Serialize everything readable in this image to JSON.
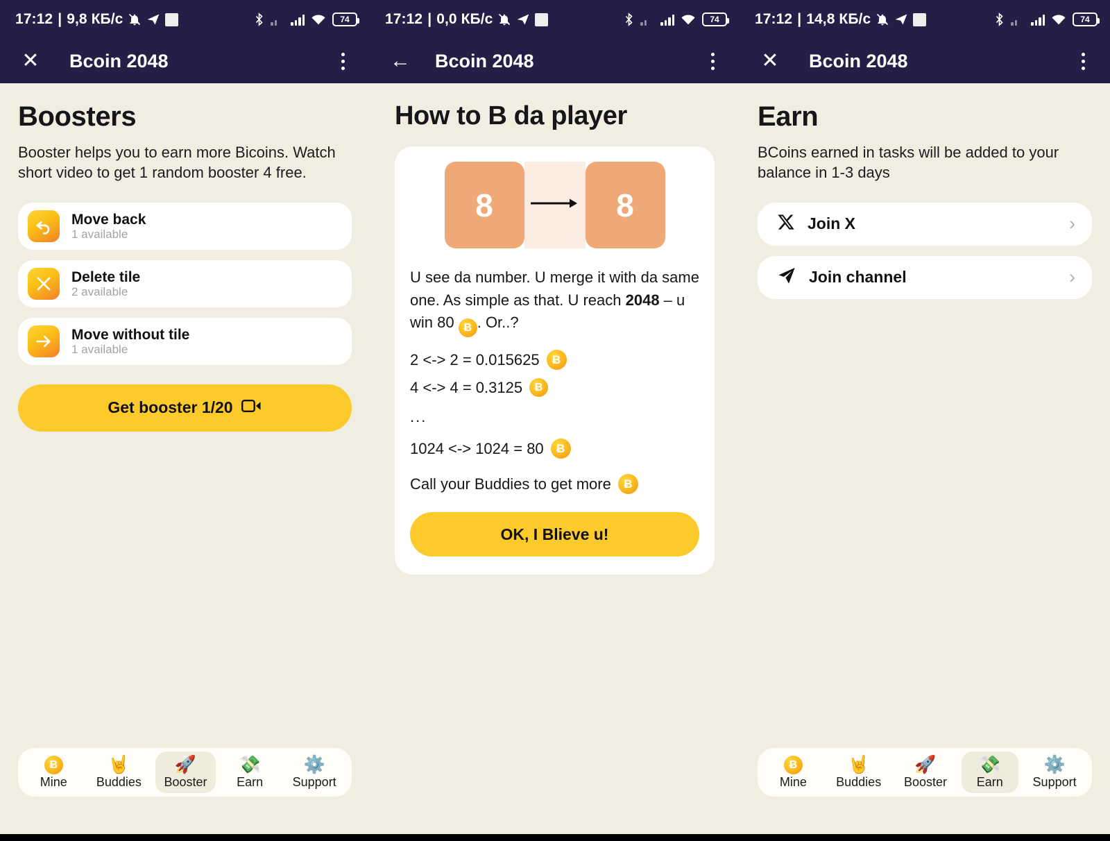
{
  "app": {
    "title": "Bcoin 2048"
  },
  "panels": [
    {
      "status": {
        "time": "17:12",
        "separator": "|",
        "net_speed": "9,8 КБ/с",
        "mute_icon": "mute-bell-icon",
        "telegram_icon": "telegram-icon",
        "screenshot_icon": "square-icon",
        "bluetooth_icon": "bluetooth-icon",
        "signal1_icon": "signal-no-sim-icon",
        "signal2_icon": "signal-bars-icon",
        "wifi_icon": "wifi-icon",
        "battery": "74"
      },
      "appbar": {
        "nav_icon": "close-icon",
        "nav_glyph": "✕",
        "title": "Bcoin 2048",
        "menu_icon": "kebab-menu-icon"
      },
      "screen_id": "boosters"
    },
    {
      "status": {
        "time": "17:12",
        "separator": "|",
        "net_speed": "0,0 КБ/с",
        "mute_icon": "mute-bell-icon",
        "telegram_icon": "telegram-icon",
        "screenshot_icon": "square-icon",
        "bluetooth_icon": "bluetooth-icon",
        "signal1_icon": "signal-no-sim-icon",
        "signal2_icon": "signal-bars-icon",
        "wifi_icon": "wifi-icon",
        "battery": "74"
      },
      "appbar": {
        "nav_icon": "back-arrow-icon",
        "nav_glyph": "←",
        "title": "Bcoin 2048",
        "menu_icon": "kebab-menu-icon"
      },
      "screen_id": "how-to-play"
    },
    {
      "status": {
        "time": "17:12",
        "separator": "|",
        "net_speed": "14,8 КБ/с",
        "mute_icon": "mute-bell-icon",
        "telegram_icon": "telegram-icon",
        "screenshot_icon": "square-icon",
        "bluetooth_icon": "bluetooth-icon",
        "signal1_icon": "signal-no-sim-icon",
        "signal2_icon": "signal-bars-icon",
        "wifi_icon": "wifi-icon",
        "battery": "74"
      },
      "appbar": {
        "nav_icon": "close-icon",
        "nav_glyph": "✕",
        "title": "Bcoin 2048",
        "menu_icon": "kebab-menu-icon"
      },
      "screen_id": "earn"
    }
  ],
  "boosters": {
    "heading": "Boosters",
    "description": "Booster helps you to earn more Bicoins. Watch short video to get 1 random booster 4 free.",
    "items": [
      {
        "icon": "undo-arrow-icon",
        "title": "Move back",
        "count": "1 available"
      },
      {
        "icon": "close-x-icon",
        "title": "Delete tile",
        "count": "2 available"
      },
      {
        "icon": "right-arrow-icon",
        "title": "Move without tile",
        "count": "1 available"
      }
    ],
    "cta": {
      "label": "Get booster 1/20",
      "icon": "video-camera-icon"
    }
  },
  "howto": {
    "heading": "How to B da player",
    "tile_left": "8",
    "tile_right": "8",
    "arrow_icon": "right-arrow-icon",
    "intro_part1": "U see da number. U merge it with da same one. As simple as that. U reach ",
    "intro_bold": "2048",
    "intro_part2": " – u win 80 ",
    "intro_part3": ". Or..?",
    "coin_glyph": "Ƀ",
    "rows": [
      {
        "text": "2 <-> 2 = 0.015625",
        "coin": true
      },
      {
        "text": "4 <-> 4 = 0.3125",
        "coin": true
      }
    ],
    "ellipsis": "...",
    "rows2": [
      {
        "text": "1024 <-> 1024 = 80",
        "coin": true
      },
      {
        "text": "Call your Buddies to get more",
        "coin": true
      }
    ],
    "ok_button": "OK, I Blieve u!"
  },
  "earn": {
    "heading": "Earn",
    "description": "BCoins earned in tasks will be added to your balance in 1-3 days",
    "tasks": [
      {
        "icon": "x-twitter-icon",
        "label": "Join X",
        "chevron": "›"
      },
      {
        "icon": "telegram-plane-icon",
        "label": "Join channel",
        "chevron": "›"
      }
    ]
  },
  "bottom_nav": {
    "items": [
      {
        "icon": "bcoin-icon",
        "glyph": "Ƀ",
        "label": "Mine"
      },
      {
        "icon": "rock-hand-icon",
        "glyph": "🤘",
        "label": "Buddies"
      },
      {
        "icon": "rocket-icon",
        "glyph": "🚀",
        "label": "Booster"
      },
      {
        "icon": "money-wings-icon",
        "glyph": "💸",
        "label": "Earn"
      },
      {
        "icon": "gear-icon",
        "glyph": "⚙️",
        "label": "Support"
      }
    ],
    "active_left": "Booster",
    "active_right": "Earn"
  },
  "colors": {
    "app_bar": "#231F47",
    "background": "#F0EDE1",
    "accent_yellow": "#FCCA2B",
    "card_white": "#FFFFFF",
    "tile_orange": "#F0A876",
    "tile_gap": "#FBEDE2"
  }
}
